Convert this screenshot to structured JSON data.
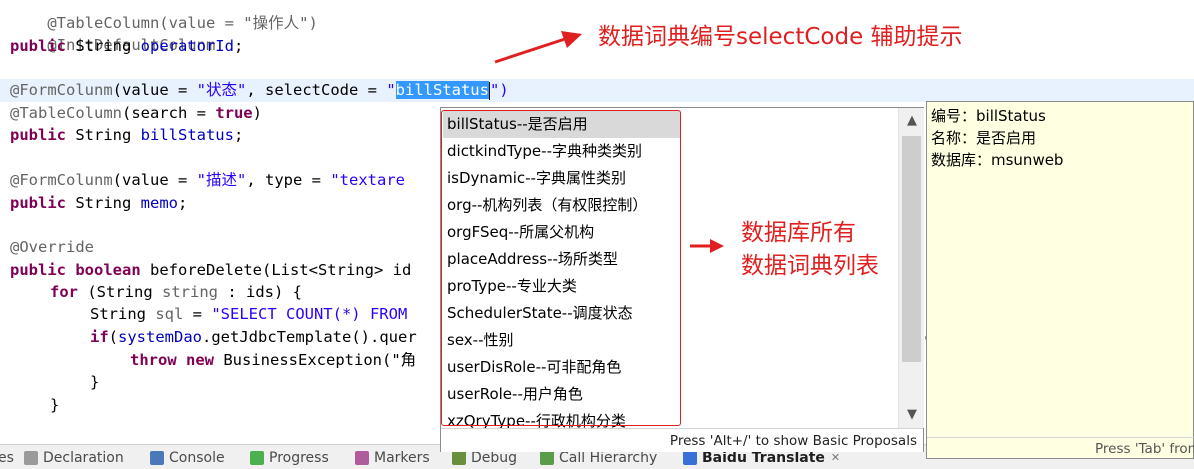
{
  "editor": {
    "lines": {
      "l01": [
        "@TableColumn(value = \"操作人\")"
      ],
      "l02": [
        "@InitDefaultColunm"
      ],
      "l03": [
        "public",
        " String ",
        "operatorId",
        ";"
      ],
      "l05": [
        "@FormColunm",
        "(value = ",
        "\"状态\"",
        ", selectCode = ",
        "\"",
        "billStatus",
        "\")"
      ],
      "l06": [
        "@TableColumn",
        "(search = ",
        "true",
        ")"
      ],
      "l07": [
        "public",
        " String ",
        "billStatus",
        ";"
      ],
      "l09": [
        "@FormColunm",
        "(value = ",
        "\"描述\"",
        ", type = ",
        "\"textare"
      ],
      "l10": [
        "public",
        " String ",
        "memo",
        ";"
      ],
      "l12": [
        "@Override"
      ],
      "l13": [
        "public",
        " ",
        "boolean",
        " beforeDelete(List<String> id"
      ],
      "l14": [
        "for",
        " (String ",
        "string",
        " : ids) {"
      ],
      "l15": [
        "String ",
        "sql",
        " = ",
        "\"SELECT COUNT(*) FROM "
      ],
      "l16": [
        "if",
        "(",
        "systemDao",
        ".getJdbcTemplate().quer"
      ],
      "l17": [
        "throw",
        " ",
        "new",
        " BusinessException(\"角"
      ],
      "l18": [
        "}"
      ],
      "l19": [
        "}"
      ]
    },
    "overflow_char": "c"
  },
  "assist": {
    "items": [
      "billStatus--是否启用",
      "dictkindType--字典种类类别",
      "isDynamic--字典属性类别",
      "org--机构列表（有权限控制）",
      "orgFSeq--所属父机构",
      "placeAddress--场所类型",
      "proType--专业大类",
      "SchedulerState--调度状态",
      "sex--性别",
      "userDisRole--可非配角色",
      "userRole--用户角色",
      "xzQryType--行政机构分类"
    ],
    "selected_index": 0,
    "footer": "Press 'Alt+/' to show Basic Proposals",
    "scroll_up": "▲",
    "scroll_down": "▼"
  },
  "detail": {
    "lines": [
      "编号：billStatus",
      "名称：是否启用",
      "数据库：msunweb"
    ],
    "footer": "Press 'Tab' from"
  },
  "annotations": {
    "top": "数据词典编号selectCode 辅助提示",
    "right_1": "数据库所有",
    "right_2": "数据词典列表"
  },
  "views": [
    {
      "label": "es",
      "icon": "none",
      "color": "#f0f0f0"
    },
    {
      "label": "Declaration",
      "icon": "declaration-icon",
      "color": "#9a9a9a"
    },
    {
      "label": "Console",
      "icon": "console-icon",
      "color": "#4a78b8"
    },
    {
      "label": "Progress",
      "icon": "progress-icon",
      "color": "#4caf50"
    },
    {
      "label": "Markers",
      "icon": "markers-icon",
      "color": "#b05c9c"
    },
    {
      "label": "Debug",
      "icon": "debug-icon",
      "color": "#6a8f3c"
    },
    {
      "label": "Call Hierarchy",
      "icon": "hierarchy-icon",
      "color": "#5a9c4a"
    },
    {
      "label": "Baidu Translate",
      "icon": "translate-icon",
      "color": "#3a6fd8"
    }
  ],
  "active_view_close": "✕",
  "colors": {
    "annotation_red": "#e02020",
    "selection_blue": "#3399ff",
    "keyword": "#7f0055",
    "string": "#2a00ff",
    "field": "#0000c0"
  }
}
